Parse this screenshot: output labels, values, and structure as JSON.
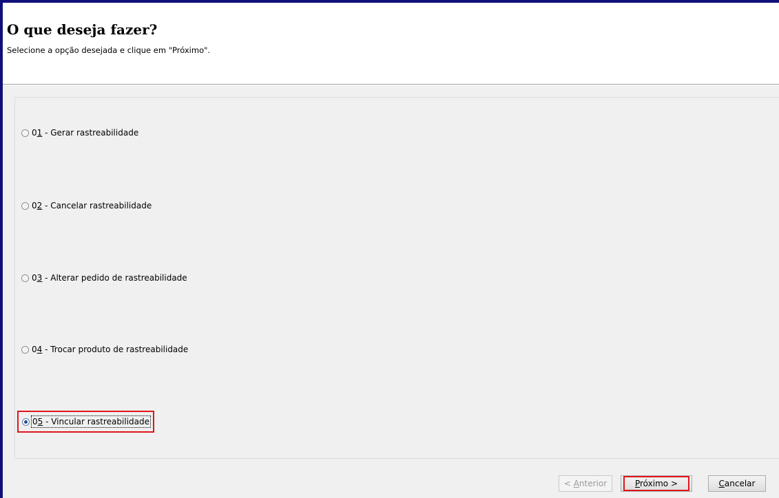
{
  "header": {
    "title": "O que deseja fazer?",
    "subtitle": "Selecione a opção desejada e clique em \"Próximo\"."
  },
  "options": [
    {
      "prefix": "0",
      "key": "1",
      "text": " - Gerar rastreabilidade",
      "selected": false
    },
    {
      "prefix": "0",
      "key": "2",
      "text": " - Cancelar rastreabilidade",
      "selected": false
    },
    {
      "prefix": "0",
      "key": "3",
      "text": " - Alterar pedido de rastreabilidade",
      "selected": false
    },
    {
      "prefix": "0",
      "key": "4",
      "text": " - Trocar produto de rastreabilidade",
      "selected": false
    },
    {
      "prefix": "0",
      "key": "5",
      "text": " - Vincular rastreabilidade",
      "selected": true
    }
  ],
  "buttons": {
    "anterior": {
      "pre": "< ",
      "key": "A",
      "rest": "nterior",
      "enabled": false
    },
    "proximo": {
      "pre": "",
      "key": "P",
      "rest": "róximo >",
      "enabled": true
    },
    "cancelar": {
      "pre": "",
      "key": "C",
      "rest": "ancelar",
      "enabled": true
    }
  },
  "colors": {
    "highlight": "#e0151b",
    "frame": "#10107a",
    "panel_bg": "#f0f0f0"
  }
}
